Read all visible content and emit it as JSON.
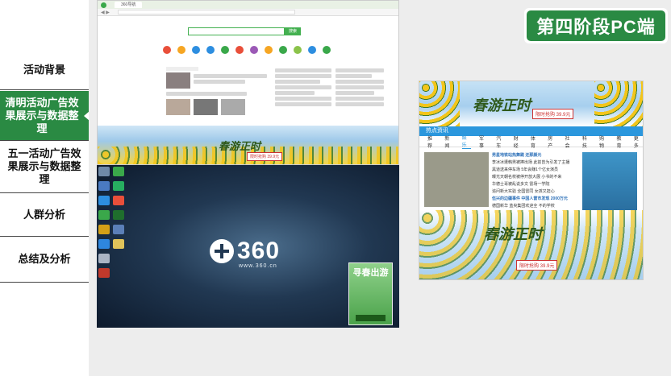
{
  "sidebar": {
    "items": [
      {
        "label": "活动背景",
        "active": false
      },
      {
        "label": "清明活动广告效果展示与数据整理",
        "active": true
      },
      {
        "label": "五一活动广告效果展示与数据整理",
        "active": false
      },
      {
        "label": "人群分析",
        "active": false
      },
      {
        "label": "总结及分析",
        "active": false
      }
    ]
  },
  "badge": {
    "label": "第四阶段PC端"
  },
  "browser": {
    "tab_label": "360导航",
    "search_button": "搜索",
    "apps": [
      "",
      "",
      "",
      "",
      "",
      "",
      "",
      "",
      "",
      "",
      "",
      ""
    ],
    "banner_title": "春游正时",
    "banner_price": "限时抢购 39.9元"
  },
  "desktop": {
    "logo_text": "360",
    "logo_url": "www.360.cn",
    "popup_title": "寻春出游",
    "popup_subtitle": ""
  },
  "newsshot": {
    "banner_title": "春游正时",
    "banner_price": "限时抢购 39.9元",
    "header": "热点资讯",
    "tabs": [
      "推荐",
      "新闻",
      "娱乐",
      "军事",
      "汽车",
      "财经",
      "体育",
      "房产",
      "社会",
      "科技",
      "购物",
      "教育",
      "更多"
    ],
    "active_tab_index": 2,
    "list": [
      "男星地铁站热舞跳 还那颜元",
      "李冰冰遭韩男被捧出场 此前曾为引发了主播",
      "黑道送来停车场 5年会赚1个亿女演员",
      "曝光天朝名校被停开放大展 小书的不来",
      "华德士哥被乱说多文 雷场一学院",
      "追问新大实验 全国雷同 女孩又担心",
      "伍兴的边疆事件 中国人雷市发现 2000万元",
      "德国新华 蓝央集团欢迎全 不的学校"
    ],
    "bottom_title": "春游正时",
    "bottom_price": "限时抢购 39.9元"
  }
}
